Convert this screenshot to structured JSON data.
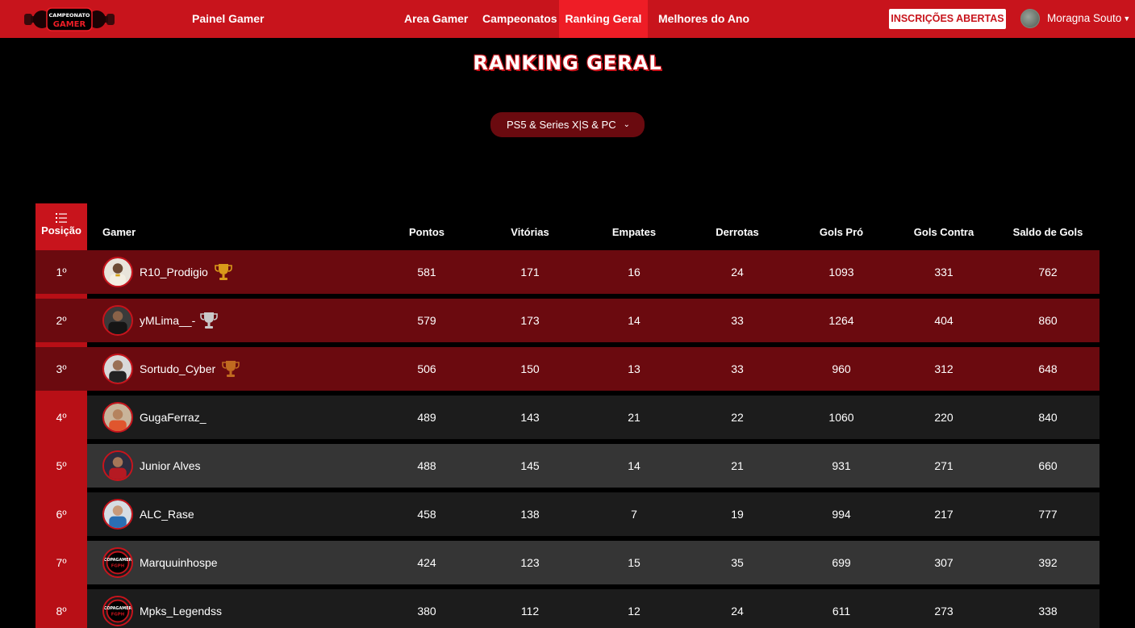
{
  "nav": {
    "panel": "Painel Gamer",
    "links": [
      "Area Gamer",
      "Campeonatos",
      "Ranking Geral",
      "Melhores do Ano"
    ],
    "active": "Ranking Geral",
    "cta": "INSCRIÇÕES ABERTAS",
    "user": "Moragna Souto"
  },
  "title": "Ranking Geral",
  "platform": "PS5 & Series X|S & PC",
  "headers": {
    "position": "Posição",
    "gamer": "Gamer",
    "points": "Pontos",
    "wins": "Vitórias",
    "draws": "Empates",
    "losses": "Derrotas",
    "goals_for": "Gols Pró",
    "goals_against": "Gols Contra",
    "goal_diff": "Saldo de Gols"
  },
  "rows": [
    {
      "pos": "1º",
      "name": "R10_Prodigio",
      "pts": "581",
      "v": "171",
      "e": "16",
      "d": "24",
      "gp": "1093",
      "gc": "331",
      "sg": "762",
      "trophy": "gold"
    },
    {
      "pos": "2º",
      "name": "yMLima__-",
      "pts": "579",
      "v": "173",
      "e": "14",
      "d": "33",
      "gp": "1264",
      "gc": "404",
      "sg": "860",
      "trophy": "silver"
    },
    {
      "pos": "3º",
      "name": "Sortudo_Cyber",
      "pts": "506",
      "v": "150",
      "e": "13",
      "d": "33",
      "gp": "960",
      "gc": "312",
      "sg": "648",
      "trophy": "bronze"
    },
    {
      "pos": "4º",
      "name": "GugaFerraz_",
      "pts": "489",
      "v": "143",
      "e": "21",
      "d": "22",
      "gp": "1060",
      "gc": "220",
      "sg": "840"
    },
    {
      "pos": "5º",
      "name": "Junior Alves",
      "pts": "488",
      "v": "145",
      "e": "14",
      "d": "21",
      "gp": "931",
      "gc": "271",
      "sg": "660"
    },
    {
      "pos": "6º",
      "name": "ALC_Rase",
      "pts": "458",
      "v": "138",
      "e": "7",
      "d": "19",
      "gp": "994",
      "gc": "217",
      "sg": "777"
    },
    {
      "pos": "7º",
      "name": "Marquuinhospe",
      "pts": "424",
      "v": "123",
      "e": "15",
      "d": "35",
      "gp": "699",
      "gc": "307",
      "sg": "392"
    },
    {
      "pos": "8º",
      "name": "Mpks_Legendss",
      "pts": "380",
      "v": "112",
      "e": "12",
      "d": "24",
      "gp": "611",
      "gc": "273",
      "sg": "338"
    }
  ],
  "logo_text": [
    "CAMPEONATO",
    "GAMER"
  ],
  "avatar_logo_text": [
    "COPAGAMER",
    "FGPH"
  ],
  "colors": {
    "brand_red": "#c8141c",
    "active_red": "#ee1d26",
    "top3_row": "#6b0a0f",
    "gold": "#d99a1a",
    "silver": "#c9c9c9",
    "bronze": "#c06a20"
  }
}
